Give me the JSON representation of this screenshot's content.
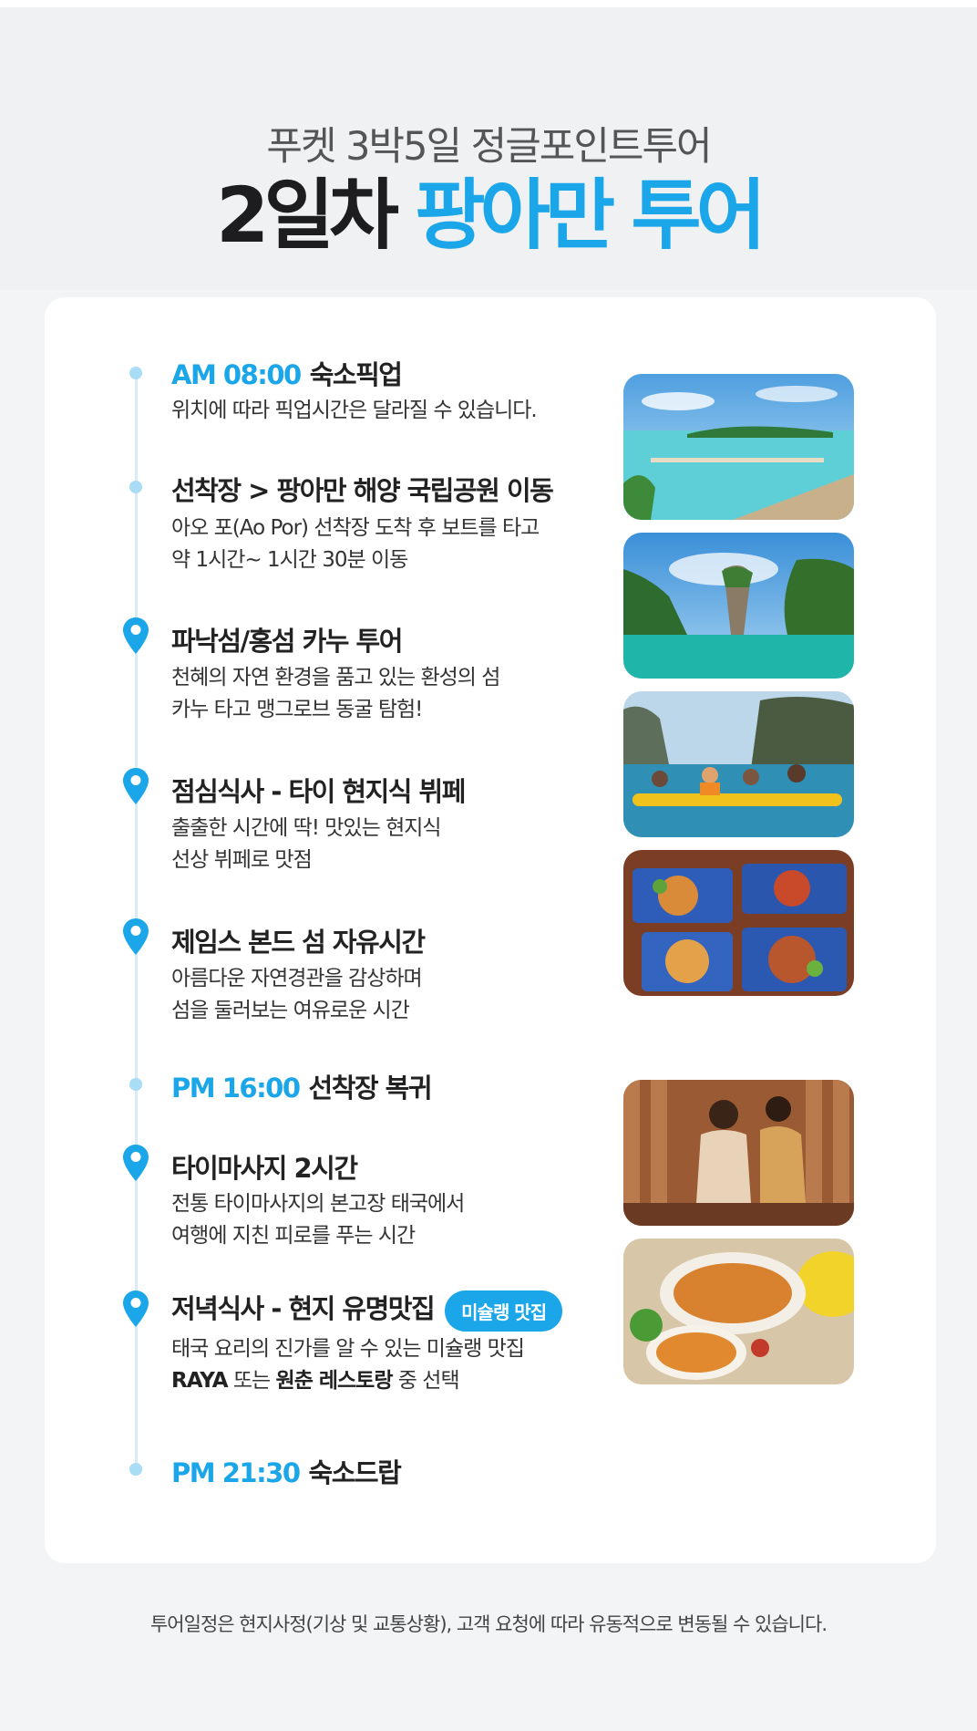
{
  "header": {
    "subtitle": "푸켓 3박5일 정글포인트투어",
    "title_dark": "2일차",
    "title_accent": "팡아만 투어"
  },
  "schedule": [
    {
      "time": "AM 08:00",
      "title": "숙소픽업",
      "desc1": "위치에 따라 픽업시간은 달라질 수 있습니다.",
      "marker": "dot"
    },
    {
      "title": "선착장 > 팡아만 해양 국립공원 이동",
      "desc1": "아오 포(Ao Por) 선착장 도착 후 보트를 타고",
      "desc2": "약 1시간~ 1시간 30분 이동",
      "marker": "dot"
    },
    {
      "title": "파낙섬/홍섬 카누 투어",
      "desc1": "천혜의 자연 환경을 품고 있는 환성의 섬",
      "desc2": "카누 타고 맹그로브 동굴 탐험!",
      "marker": "pin"
    },
    {
      "title": "점심식사 - 타이 현지식 뷔페",
      "desc1": "출출한 시간에 딱! 맛있는 현지식",
      "desc2": "선상 뷔페로 맛점",
      "marker": "pin"
    },
    {
      "title": "제임스 본드 섬 자유시간",
      "desc1": "아름다운 자연경관을 감상하며",
      "desc2": "섬을 둘러보는 여유로운 시간",
      "marker": "pin"
    },
    {
      "time": "PM 16:00",
      "title": "선착장 복귀",
      "marker": "dot"
    },
    {
      "title": "타이마사지 2시간",
      "desc1": "전통 타이마사지의 본고장 태국에서",
      "desc2": "여행에 지친 피로를 푸는 시간",
      "marker": "pin"
    },
    {
      "title": "저녁식사 - 현지 유명맛집",
      "badge": "미슐랭 맛집",
      "desc1": "태국 요리의 진가를 알 수 있는 미슐랭 맛집",
      "desc2_bold1": "RAYA",
      "desc2_mid": " 또는 ",
      "desc2_bold2": "원춘 레스토랑",
      "desc2_end": " 중 선택",
      "marker": "pin"
    },
    {
      "time": "PM 21:30",
      "title": "숙소드랍",
      "marker": "dot"
    }
  ],
  "photos": [
    {
      "name": "island-pier-photo"
    },
    {
      "name": "james-bond-island-photo"
    },
    {
      "name": "canoe-tour-photo"
    },
    {
      "name": "buffet-food-photo"
    },
    {
      "name": "thai-massage-photo"
    },
    {
      "name": "dinner-dish-photo"
    }
  ],
  "colors": {
    "accent": "#1aa6e8",
    "timeline": "#a9dcf5"
  },
  "footer": {
    "note": "투어일정은 현지사정(기상 및 교통상황), 고객 요청에 따라 유동적으로 변동될 수 있습니다."
  }
}
